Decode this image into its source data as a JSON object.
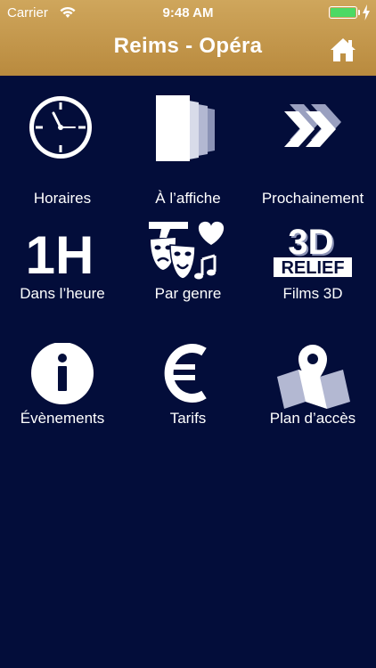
{
  "status_bar": {
    "carrier": "Carrier",
    "time": "9:48 AM"
  },
  "header": {
    "title": "Reims - Opéra",
    "home_icon": "home-icon"
  },
  "colors": {
    "header_gold": "#c49a4e",
    "background": "#030d3a",
    "battery_green": "#4cd964"
  },
  "menu": [
    {
      "label": "Horaires",
      "icon": "clock-icon"
    },
    {
      "label": "À l’affiche",
      "icon": "posters-icon"
    },
    {
      "label": "Prochainement",
      "icon": "fast-forward-icon"
    },
    {
      "label": "Dans l’heure",
      "icon": "one-hour-icon"
    },
    {
      "label": "Par genre",
      "icon": "genre-icon"
    },
    {
      "label": "Films 3D",
      "icon": "3d-relief-icon"
    },
    {
      "label": "Évènements",
      "icon": "info-icon"
    },
    {
      "label": "Tarifs",
      "icon": "euro-icon"
    },
    {
      "label": "Plan d’accès",
      "icon": "map-icon"
    }
  ],
  "icon_text": {
    "one_hour": "1H",
    "three_d": "3D",
    "relief": "RELIEF"
  }
}
